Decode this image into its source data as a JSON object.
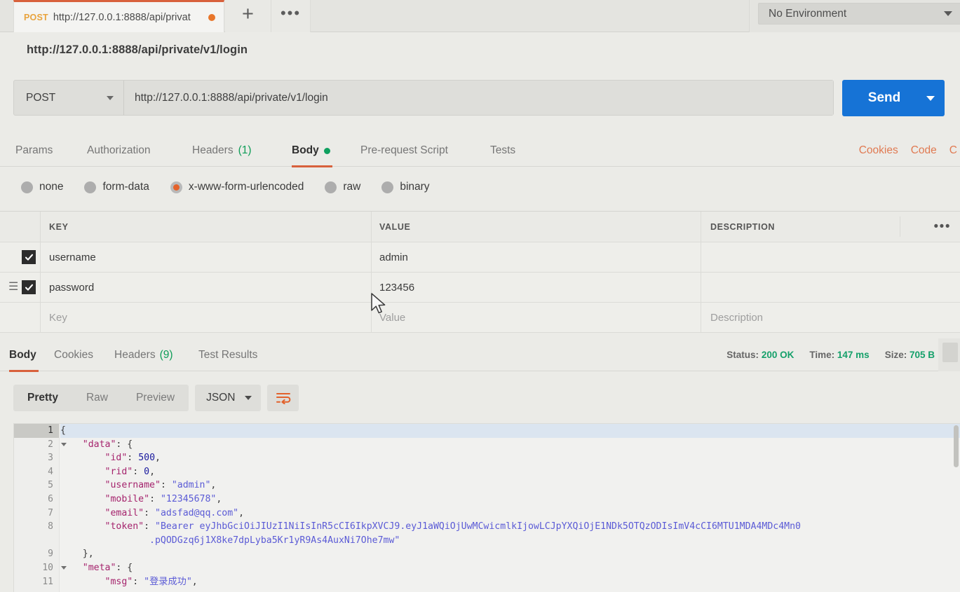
{
  "tabstrip": {
    "request_tab": {
      "method": "POST",
      "url": "http://127.0.0.1:8888/api/privat",
      "unsaved": true
    },
    "new_tab_label": "+",
    "more_label": "•••",
    "environment": {
      "selected": "No Environment"
    }
  },
  "request": {
    "title": "http://127.0.0.1:8888/api/private/v1/login",
    "method": "POST",
    "url": "http://127.0.0.1:8888/api/private/v1/login",
    "send_label": "Send"
  },
  "request_tabs": [
    {
      "label": "Params",
      "active": false
    },
    {
      "label": "Authorization",
      "active": false
    },
    {
      "label": "Headers",
      "count": "(1)",
      "active": false
    },
    {
      "label": "Body",
      "active": true,
      "dot": true
    },
    {
      "label": "Pre-request Script",
      "active": false
    },
    {
      "label": "Tests",
      "active": false
    }
  ],
  "right_links": [
    {
      "label": "Cookies"
    },
    {
      "label": "Code"
    },
    {
      "label": "C"
    }
  ],
  "body_types": [
    {
      "label": "none",
      "selected": false
    },
    {
      "label": "form-data",
      "selected": false
    },
    {
      "label": "x-www-form-urlencoded",
      "selected": true
    },
    {
      "label": "raw",
      "selected": false
    },
    {
      "label": "binary",
      "selected": false
    }
  ],
  "param_table": {
    "headers": {
      "key": "KEY",
      "value": "VALUE",
      "description": "DESCRIPTION",
      "bulk": "•••"
    },
    "rows": [
      {
        "checked": true,
        "key": "username",
        "value": "admin",
        "description": "",
        "drag": false
      },
      {
        "checked": true,
        "key": "password",
        "value": "123456",
        "description": "",
        "drag": true
      }
    ],
    "placeholder_row": {
      "key": "Key",
      "value": "Value",
      "description": "Description"
    }
  },
  "response": {
    "tabs": [
      {
        "label": "Body",
        "active": true
      },
      {
        "label": "Cookies",
        "active": false
      },
      {
        "label": "Headers",
        "count": "(9)",
        "active": false
      },
      {
        "label": "Test Results",
        "active": false
      }
    ],
    "status_label": "Status:",
    "status_value": "200 OK",
    "time_label": "Time:",
    "time_value": "147 ms",
    "size_label": "Size:",
    "size_value": "705 B",
    "view_modes": [
      {
        "label": "Pretty",
        "active": true
      },
      {
        "label": "Raw",
        "active": false
      },
      {
        "label": "Preview",
        "active": false
      }
    ],
    "format": "JSON",
    "wrap_icon": "word-wrap-icon"
  },
  "code": {
    "lines": [
      {
        "n": "1",
        "fold": true,
        "current": true,
        "indent": 0,
        "tokens": [
          {
            "t": "pun",
            "v": "{"
          }
        ]
      },
      {
        "n": "2",
        "fold": true,
        "current": false,
        "indent": 1,
        "tokens": [
          {
            "t": "key",
            "v": "\"data\""
          },
          {
            "t": "pun",
            "v": ": {"
          }
        ]
      },
      {
        "n": "3",
        "fold": false,
        "current": false,
        "indent": 2,
        "tokens": [
          {
            "t": "key",
            "v": "\"id\""
          },
          {
            "t": "pun",
            "v": ": "
          },
          {
            "t": "num",
            "v": "500"
          },
          {
            "t": "pun",
            "v": ","
          }
        ]
      },
      {
        "n": "4",
        "fold": false,
        "current": false,
        "indent": 2,
        "tokens": [
          {
            "t": "key",
            "v": "\"rid\""
          },
          {
            "t": "pun",
            "v": ": "
          },
          {
            "t": "num",
            "v": "0"
          },
          {
            "t": "pun",
            "v": ","
          }
        ]
      },
      {
        "n": "5",
        "fold": false,
        "current": false,
        "indent": 2,
        "tokens": [
          {
            "t": "key",
            "v": "\"username\""
          },
          {
            "t": "pun",
            "v": ": "
          },
          {
            "t": "str",
            "v": "\"admin\""
          },
          {
            "t": "pun",
            "v": ","
          }
        ]
      },
      {
        "n": "6",
        "fold": false,
        "current": false,
        "indent": 2,
        "tokens": [
          {
            "t": "key",
            "v": "\"mobile\""
          },
          {
            "t": "pun",
            "v": ": "
          },
          {
            "t": "str",
            "v": "\"12345678\""
          },
          {
            "t": "pun",
            "v": ","
          }
        ]
      },
      {
        "n": "7",
        "fold": false,
        "current": false,
        "indent": 2,
        "tokens": [
          {
            "t": "key",
            "v": "\"email\""
          },
          {
            "t": "pun",
            "v": ": "
          },
          {
            "t": "str",
            "v": "\"adsfad@qq.com\""
          },
          {
            "t": "pun",
            "v": ","
          }
        ]
      },
      {
        "n": "8",
        "fold": false,
        "current": false,
        "indent": 2,
        "tokens": [
          {
            "t": "key",
            "v": "\"token\""
          },
          {
            "t": "pun",
            "v": ": "
          },
          {
            "t": "str",
            "v": "\"Bearer eyJhbGciOiJIUzI1NiIsInR5cCI6IkpXVCJ9.eyJ1aWQiOjUwMCwicmlkIjowLCJpYXQiOjE1NDk5OTQzODIsImV4cCI6MTU1MDA4MDc4Mn0"
          }
        ]
      },
      {
        "n": "",
        "fold": false,
        "current": false,
        "indent": 4,
        "tokens": [
          {
            "t": "str",
            "v": ".pQODGzq6j1X8ke7dpLyba5Kr1yR9As4AuxNi7Ohe7mw\""
          }
        ]
      },
      {
        "n": "9",
        "fold": false,
        "current": false,
        "indent": 1,
        "tokens": [
          {
            "t": "pun",
            "v": "},"
          }
        ]
      },
      {
        "n": "10",
        "fold": true,
        "current": false,
        "indent": 1,
        "tokens": [
          {
            "t": "key",
            "v": "\"meta\""
          },
          {
            "t": "pun",
            "v": ": {"
          }
        ]
      },
      {
        "n": "11",
        "fold": false,
        "current": false,
        "indent": 2,
        "tokens": [
          {
            "t": "key",
            "v": "\"msg\""
          },
          {
            "t": "pun",
            "v": ": "
          },
          {
            "t": "str",
            "v": "\"登录成功\""
          },
          {
            "t": "pun",
            "v": ","
          }
        ]
      }
    ]
  },
  "colors": {
    "accent_orange": "#d8613c",
    "send_blue": "#1673d6",
    "status_green": "#15a06a",
    "method_amber": "#e8a33d",
    "unsaved_dot": "#e8762b"
  }
}
